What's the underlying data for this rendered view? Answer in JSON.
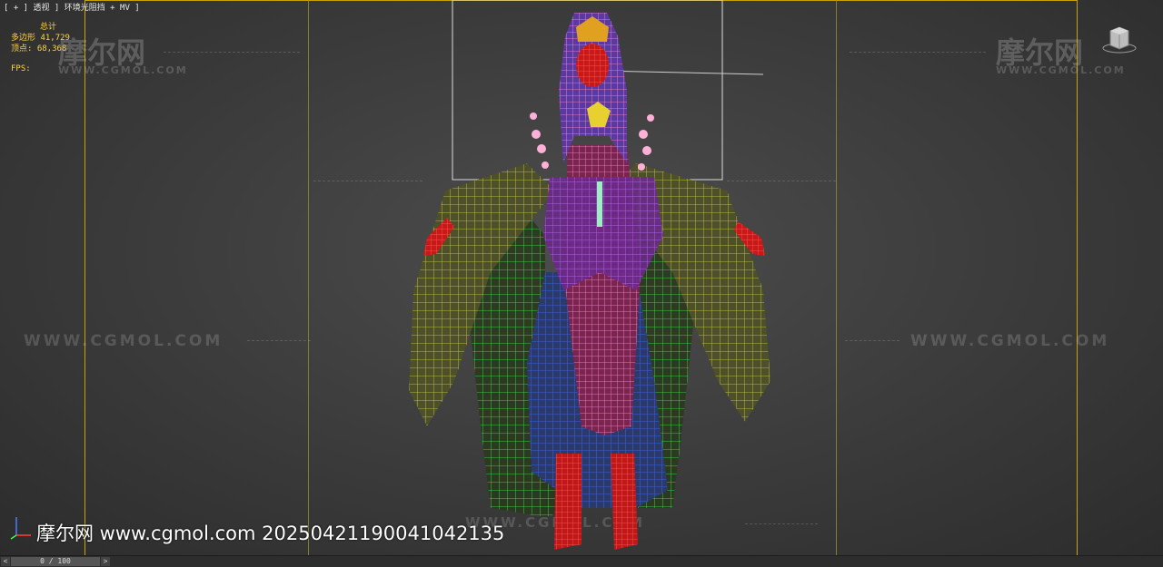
{
  "viewport": {
    "label": "[ + ] 透视 ] 环境光阻挡 + MV ]"
  },
  "stats": {
    "title": "总计",
    "polys_label": "多边形",
    "polys_value": "41,729",
    "verts_label": "顶点:",
    "verts_value": "68,368",
    "fps_label": "FPS:"
  },
  "watermarks": {
    "logo_text": "摩尔网",
    "logo_sub": "WWW.CGMOL.COM",
    "url_text": "WWW.CGMOL.COM"
  },
  "footer": {
    "text": "摩尔网 www.cgmol.com 20250421190041042135"
  },
  "timeline": {
    "frame_text": "0 / 100",
    "prev_label": "<",
    "next_label": ">"
  },
  "icons": {
    "viewcube": "viewcube-icon",
    "axis": "axis-tripod-icon"
  },
  "colors": {
    "safe_frame": "#c9a400",
    "stats_text": "#ffd24a",
    "wire_robe": "#c8c844",
    "wire_body": "#e0287a",
    "wire_blue": "#2a50e0",
    "wire_green": "#30e040",
    "skin_red": "#d81818"
  }
}
